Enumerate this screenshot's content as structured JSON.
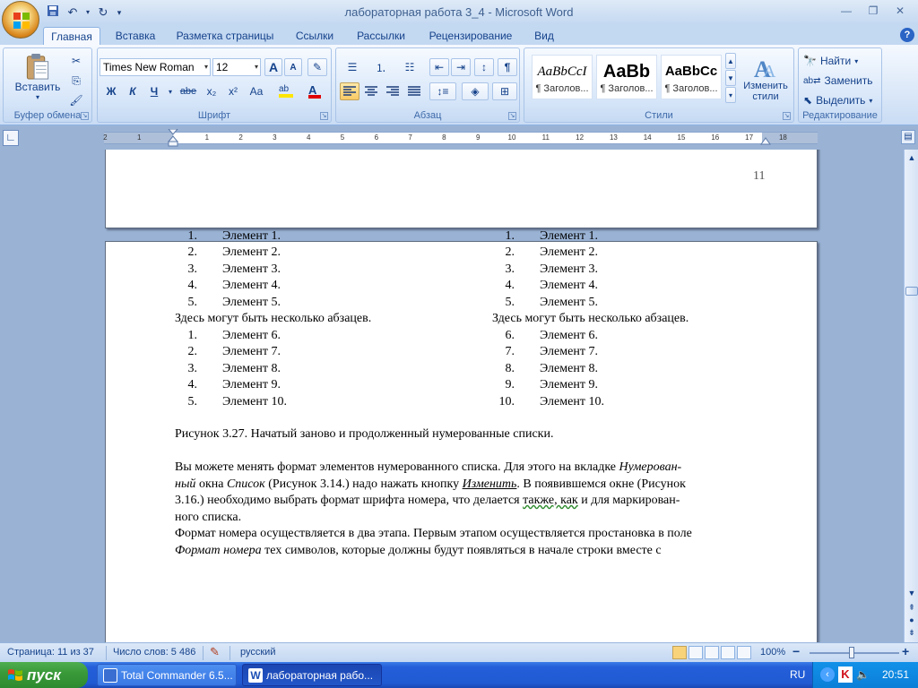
{
  "window": {
    "title": "лабораторная работа 3_4 - Microsoft Word"
  },
  "quick_access": [
    "save-icon",
    "undo-icon",
    "redo-icon",
    "customize-qat-icon"
  ],
  "tabs": [
    "Главная",
    "Вставка",
    "Разметка страницы",
    "Ссылки",
    "Рассылки",
    "Рецензирование",
    "Вид"
  ],
  "ribbon": {
    "clipboard": {
      "label": "Буфер обмена",
      "paste": "Вставить"
    },
    "font": {
      "label": "Шрифт",
      "font_name": "Times New Roman",
      "font_size": "12",
      "bold": "Ж",
      "italic": "К",
      "underline": "Ч",
      "strike": "abe",
      "sub": "x₂",
      "sup": "x²",
      "case": "Aa",
      "grow": "A",
      "shrink": "A"
    },
    "paragraph": {
      "label": "Абзац",
      "pilcrow": "¶"
    },
    "styles": {
      "label": "Стили",
      "items": [
        {
          "sample": "AaBbCcI",
          "name": "¶ Заголов..."
        },
        {
          "sample": "AaBb",
          "name": "¶ Заголов..."
        },
        {
          "sample": "AaBbCc",
          "name": "¶ Заголов..."
        }
      ],
      "change": "Изменить стили"
    },
    "editing": {
      "label": "Редактирование",
      "find": "Найти",
      "replace": "Заменить",
      "select": "Выделить"
    }
  },
  "ruler": {
    "ticks": [
      "2",
      "1",
      "1",
      "2",
      "3",
      "4",
      "5",
      "6",
      "7",
      "8",
      "9",
      "10",
      "11",
      "12",
      "13",
      "14",
      "15",
      "16",
      "17",
      "18"
    ]
  },
  "document": {
    "prev_page_number": "11",
    "left_list_a": [
      {
        "num": "1.",
        "text": "Элемент 1."
      },
      {
        "num": "2.",
        "text": "Элемент 2."
      },
      {
        "num": "3.",
        "text": "Элемент 3."
      },
      {
        "num": "4.",
        "text": "Элемент 4."
      },
      {
        "num": "5.",
        "text": "Элемент 5."
      }
    ],
    "left_between": "Здесь могут быть несколько абзацев.",
    "left_list_b": [
      {
        "num": "1.",
        "text": "Элемент 6."
      },
      {
        "num": "2.",
        "text": "Элемент 7."
      },
      {
        "num": "3.",
        "text": "Элемент 8."
      },
      {
        "num": "4.",
        "text": "Элемент 9."
      },
      {
        "num": "5.",
        "text": "Элемент 10."
      }
    ],
    "right_list_a": [
      {
        "num": "1.",
        "text": "Элемент 1."
      },
      {
        "num": "2.",
        "text": "Элемент 2."
      },
      {
        "num": "3.",
        "text": "Элемент 3."
      },
      {
        "num": "4.",
        "text": "Элемент 4."
      },
      {
        "num": "5.",
        "text": "Элемент 5."
      }
    ],
    "right_between": "Здесь могут быть несколько абзацев.",
    "right_list_b": [
      {
        "num": "6.",
        "text": "Элемент 6."
      },
      {
        "num": "7.",
        "text": "Элемент 7."
      },
      {
        "num": "8.",
        "text": "Элемент 8."
      },
      {
        "num": "9.",
        "text": "Элемент 9."
      },
      {
        "num": "10.",
        "text": "Элемент 10."
      }
    ],
    "caption": "Рисунок 3.27.  Начатый заново и продолженный нумерованные списки.",
    "para1": {
      "l1a": "Вы можете менять формат элементов нумерованного списка. Для этого на вкладке ",
      "l1b": "Нумерован-",
      "l2a": "ный",
      "l2b": " окна ",
      "l2c": "Список",
      "l2d": " (Рисунок 3.14.) надо нажать кнопку ",
      "l2e": "Изменить",
      "l2f": ". В появившемся окне (Рисунок",
      "l3a": "3.16.) необходимо выбрать формат шрифта номера, что делается ",
      "l3b": "также, как",
      "l3c": " и для маркирован-",
      "l4": "ного списка."
    },
    "para2": {
      "l1": "Формат номера осуществляется в два этапа. Первым этапом осуществляется простановка в поле",
      "l2a": "Формат номера",
      "l2b": " тех символов, которые должны будут появляться в начале строки вместе с"
    }
  },
  "status": {
    "page": "Страница: 11 из 37",
    "words": "Число слов: 5 486",
    "language": "русский",
    "zoom": "100%",
    "zoom_minus": "−",
    "zoom_plus": "+"
  },
  "taskbar": {
    "start": "пуск",
    "tasks": [
      {
        "label": "Total Commander 6.5...",
        "active": false
      },
      {
        "label": "лабораторная рабо...",
        "active": true
      }
    ],
    "lang": "RU",
    "clock": "20:51"
  },
  "colors": {
    "accent": "#15428b",
    "ribbon": "#dbe8f8",
    "taskbar": "#245ed8",
    "start": "#3a9a3a"
  }
}
